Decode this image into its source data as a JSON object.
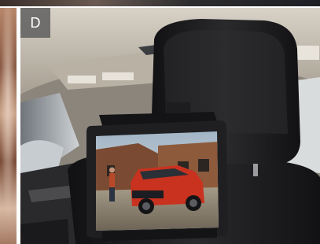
{
  "badge": {
    "letter": "D"
  },
  "colors": {
    "headliner": "#c9c2b6",
    "seat_leather": "#1b1b1d",
    "tablet_frame": "#1f1f22",
    "suv_paint": "#c8321f"
  }
}
